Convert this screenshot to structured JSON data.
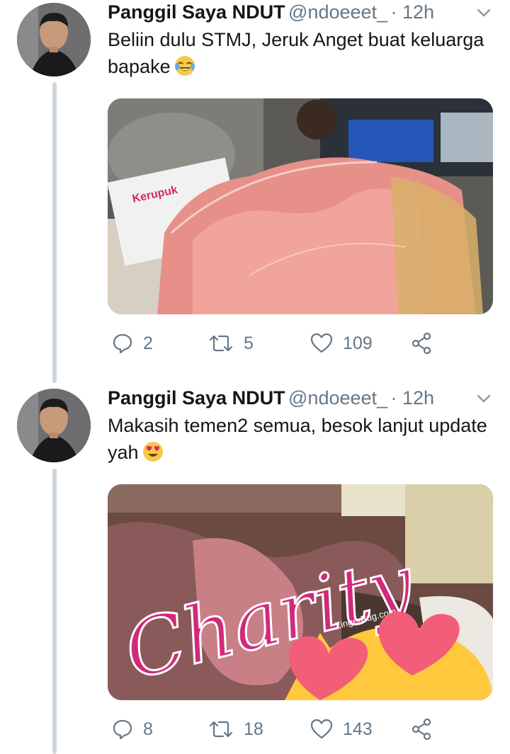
{
  "tweets": [
    {
      "name": "Panggil Saya NDUT",
      "handle": "@ndoeeet_",
      "time": "· 12h",
      "text": "Beliin dulu STMJ, Jeruk Anget buat keluarga bapake",
      "emoji": "face-with-tears-of-joy",
      "media_caption_text": "Kerupuk",
      "replies": "2",
      "retweets": "5",
      "likes": "109"
    },
    {
      "name": "Panggil Saya NDUT",
      "handle": "@ndoeeet_",
      "time": "· 12h",
      "text": "Makasih temen2 semua, besok lanjut update yah",
      "emoji": "smiling-face-with-heart-eyes",
      "media_overlay_text": "Charity",
      "media_watermark": "ZingerBug.com",
      "replies": "8",
      "retweets": "18",
      "likes": "143"
    }
  ],
  "colors": {
    "text": "#14171a",
    "secondary": "#657786",
    "thread": "#ccd6dd",
    "charity_pink": "#d12a7a",
    "heart": "#f25e78"
  },
  "icons": [
    "reply-icon",
    "retweet-icon",
    "like-icon",
    "share-icon",
    "chevron-down-icon"
  ]
}
